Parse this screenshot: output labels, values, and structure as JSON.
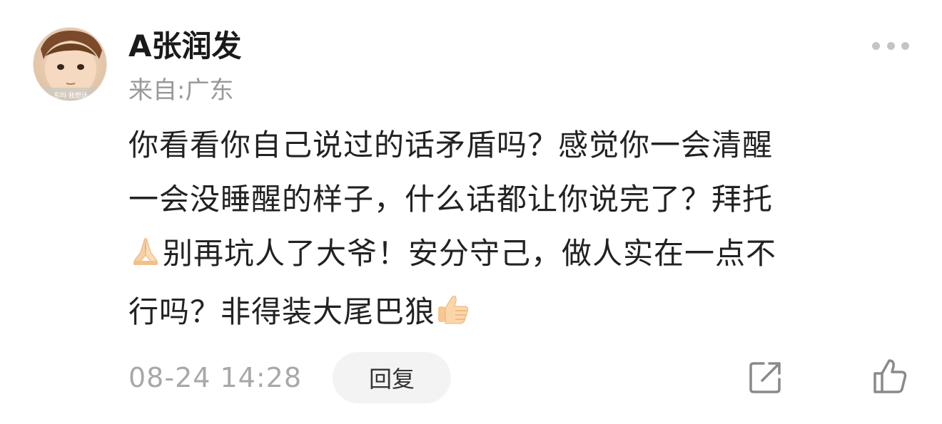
{
  "comment": {
    "avatar_icon": "child-photo-avatar",
    "avatar_caption": "东吗 我想话",
    "username": "A张润发",
    "location": "来自:广东",
    "more_icon": "more-dots-icon",
    "body_lines": [
      "你看看你自己说过的话矛盾吗？感觉你一会清醒",
      "一会没睡醒的样子，什么话都让你说完了？拜托",
      "别再坑人了大爷！安分守己，做人实在一点不",
      "行吗？非得装大尾巴狼"
    ],
    "body_emojis": [
      "folded-hands-emoji",
      "thumbs-up-emoji"
    ],
    "timestamp": "08-24 14:28",
    "reply_label": "回复",
    "share_icon": "share-icon",
    "like_icon": "thumbs-up-icon",
    "colors": {
      "text_primary": "#222222",
      "text_secondary": "#999999",
      "reply_bg": "#f3f3f3",
      "icon_gray": "#8a8a8a"
    }
  }
}
